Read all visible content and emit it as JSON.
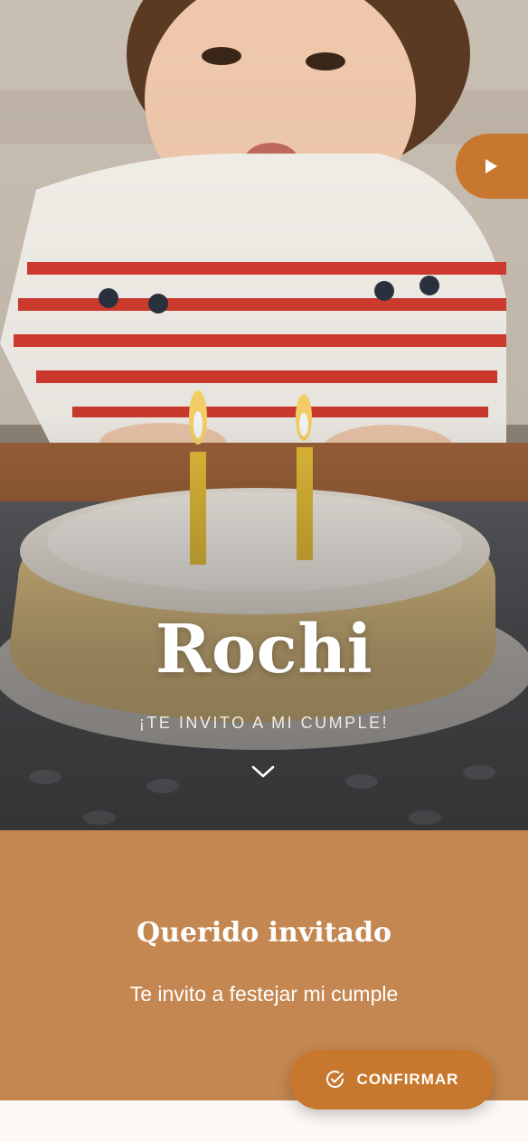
{
  "hero": {
    "name": "Rochi",
    "subtitle": "¡TE INVITO A MI CUMPLE!",
    "image": "birthday-child-blowing-candles-photo"
  },
  "intro": {
    "title": "Querido invitado",
    "text": "Te invito a festejar mi cumple"
  },
  "actions": {
    "play_icon": "play-icon",
    "scroll_icon": "chevron-down-icon",
    "confirm_label": "CONFIRMAR",
    "confirm_icon": "check-circle-icon"
  },
  "colors": {
    "accent": "#c8782e",
    "section_bg": "#c48751",
    "page_bg": "#fbf8f5"
  }
}
